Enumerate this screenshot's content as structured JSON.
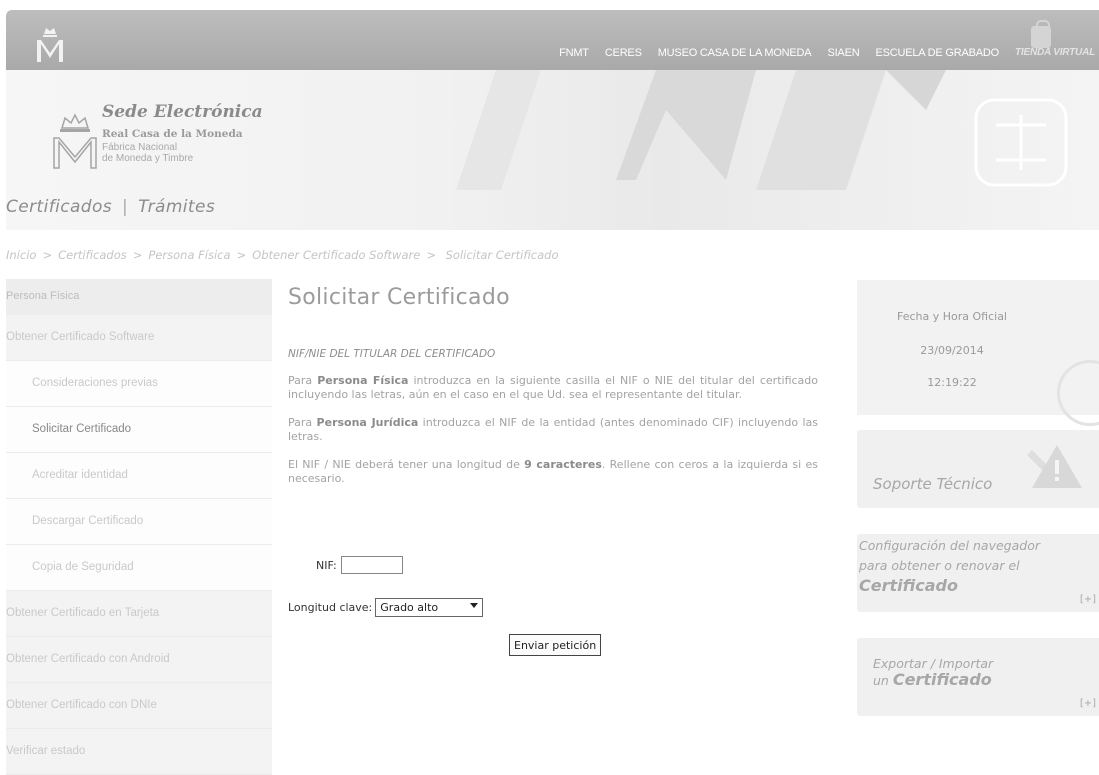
{
  "topnav": {
    "items": [
      "FNMT",
      "CERES",
      "MUSEO CASA DE LA MONEDA",
      "SIAEN",
      "ESCUELA DE GRABADO"
    ],
    "tienda": "TIENDA VIRTUAL"
  },
  "header": {
    "title": "Sede Electrónica",
    "sub1": "Real Casa de la Moneda",
    "sub2a": "Fábrica Nacional",
    "sub2b": "de Moneda y Timbre",
    "nav": [
      "Certificados",
      "Trámites"
    ]
  },
  "breadcrumb": [
    "Inicio",
    "Certificados",
    "Persona Física",
    "Obtener Certificado Software",
    "Solicitar Certificado"
  ],
  "sidebar": {
    "head": "Persona Física",
    "items": [
      {
        "label": "Obtener Certificado Software",
        "level": 1
      },
      {
        "label": "Consideraciones previas",
        "level": 2
      },
      {
        "label": "Solicitar Certificado",
        "level": 2
      },
      {
        "label": "Acreditar identidad",
        "level": 2
      },
      {
        "label": "Descargar Certificado",
        "level": 2
      },
      {
        "label": "Copia de Seguridad",
        "level": 2
      },
      {
        "label": "Obtener Certificado en Tarjeta",
        "level": 1
      },
      {
        "label": "Obtener Certificado con Android",
        "level": 1
      },
      {
        "label": "Obtener Certificado con DNIe",
        "level": 1
      },
      {
        "label": "Verificar estado",
        "level": 1
      }
    ]
  },
  "main": {
    "title": "Solicitar Certificado",
    "section": "NIF/NIE DEL TITULAR DEL CERTIFICADO",
    "p1_a": "Para ",
    "p1_b": "Persona Física",
    "p1_c": " introduzca en la siguiente casilla el NIF o NIE del titular del certificado incluyendo las letras, aún en el caso en el que Ud. sea el representante del titular.",
    "p2_a": "Para ",
    "p2_b": "Persona Jurídica",
    "p2_c": " introduzca el NIF de la entidad (antes denominado CIF) incluyendo las letras.",
    "p3_a": "El NIF / NIE deberá tener una longitud de ",
    "p3_b": "9 caracteres",
    "p3_c": ". Rellene con ceros a la izquierda si es necesario."
  },
  "form": {
    "nif_label": "NIF:",
    "nif_value": "",
    "clave_label": "Longitud clave:",
    "clave_value": "Grado alto",
    "submit": "Enviar petición"
  },
  "right": {
    "clock_title": "Fecha y Hora Oficial",
    "date": "23/09/2014",
    "time": "12:19:22",
    "soporte": "Soporte Técnico",
    "config1": "Configuración del navegador",
    "config2": "para obtener o renovar el",
    "config3": "Certificado",
    "export1": "Exportar / Importar",
    "export2a": "un ",
    "export2b": "Certificado",
    "plus": "[+]"
  }
}
